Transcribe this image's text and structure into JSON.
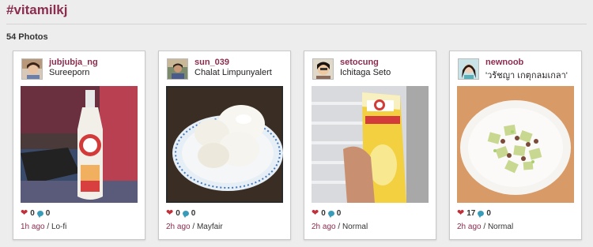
{
  "header": {
    "hashtag": "#vitamilkj",
    "photo_count": "54 Photos"
  },
  "cards": [
    {
      "username": "jubjubja_ng",
      "fullname": "Sureeporn",
      "likes": "0",
      "comments": "0",
      "time": "1h ago",
      "sep": " / ",
      "filter": "Lo-fi"
    },
    {
      "username": "sun_039",
      "fullname": "Chalat Limpunyalert",
      "likes": "0",
      "comments": "0",
      "time": "2h ago",
      "sep": " / ",
      "filter": "Mayfair"
    },
    {
      "username": "setocung",
      "fullname": "Ichitaga Seto",
      "likes": "0",
      "comments": "0",
      "time": "2h ago",
      "sep": " / ",
      "filter": "Normal"
    },
    {
      "username": "newnoob",
      "fullname": "'วรัชญา เกตุกลมเกลา'",
      "likes": "17",
      "comments": "0",
      "time": "2h ago",
      "sep": " / ",
      "filter": "Normal"
    }
  ],
  "icons": {
    "like": "heart-icon",
    "comment": "comment-bubble-icon"
  },
  "colors": {
    "accent": "#8b2d4f",
    "heart": "#c0303a",
    "comment": "#3a9bb8"
  }
}
